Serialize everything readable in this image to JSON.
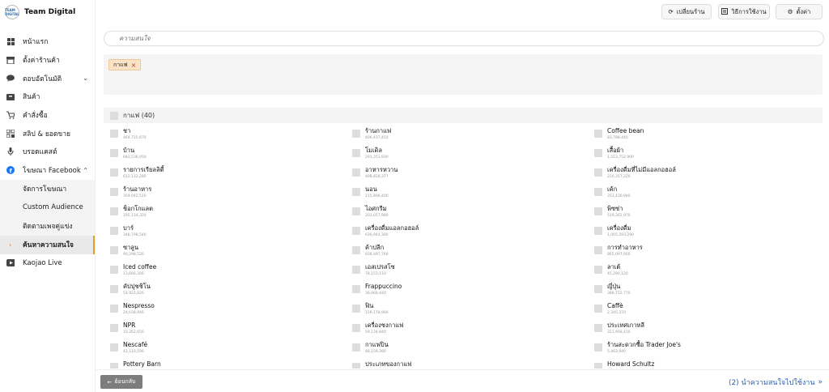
{
  "brand": {
    "logo_text": "TEAM DIGITAL",
    "name": "Team Digital"
  },
  "top_buttons": [
    {
      "label": "เปลี่ยนร้าน",
      "icon": "refresh-icon"
    },
    {
      "label": "วิธีการใช้งาน",
      "icon": "book-icon"
    },
    {
      "label": "ตั้งค่า",
      "icon": "gear-icon"
    }
  ],
  "sidebar": {
    "items": [
      {
        "label": "หน้าแรก",
        "icon": "grid-icon"
      },
      {
        "label": "ตั้งค่าร้านค้า",
        "icon": "store-icon"
      },
      {
        "label": "ตอบอัตโนมัติ",
        "icon": "chat-icon"
      },
      {
        "label": "สินค้า",
        "icon": "box-icon"
      },
      {
        "label": "คำสั่งซื้อ",
        "icon": "cart-icon"
      },
      {
        "label": "สลิป & ยอดขาย",
        "icon": "receipt-icon"
      },
      {
        "label": "บรอดแคสต์",
        "icon": "mic-icon"
      },
      {
        "label": "โฆษณา Facebook",
        "icon": "facebook-icon"
      }
    ],
    "sub_items": [
      {
        "label": "จัดการโฆษณา"
      },
      {
        "label": "Custom Audience"
      },
      {
        "label": "ติดตามเพจคู่แข่ง"
      },
      {
        "label": "ค้นหาความสนใจ"
      }
    ],
    "last_item": {
      "label": "Kaojao Live",
      "icon": "live-icon"
    }
  },
  "search": {
    "placeholder": "ความสนใจ"
  },
  "selected": [
    {
      "label": "กาแฟ"
    }
  ],
  "group": {
    "title": "กาแฟ (40)"
  },
  "interests": {
    "col1": [
      {
        "label": "ชา",
        "count": "464,725,670"
      },
      {
        "label": "บ้าน",
        "count": "683,536,950"
      },
      {
        "label": "รายการเรียลลิตี้",
        "count": "612,132,280"
      },
      {
        "label": "ร้านอาหาร",
        "count": "359,042,510"
      },
      {
        "label": "ช็อกโกแลต",
        "count": "195,134,320"
      },
      {
        "label": "บาร์",
        "count": "348,798,540"
      },
      {
        "label": "ซาลูน",
        "count": "90,298,520"
      },
      {
        "label": "Iced coffee",
        "count": "13,666,300"
      },
      {
        "label": "คัปปุชชิโน",
        "count": "54,922,820"
      },
      {
        "label": "Nespresso",
        "count": "24,038,940"
      },
      {
        "label": "NPR",
        "count": "33,262,650"
      },
      {
        "label": "Nescafé",
        "count": "42,110,590"
      },
      {
        "label": "Pottery Barn",
        "count": ""
      }
    ],
    "col2": [
      {
        "label": "ร้านกาแฟ",
        "count": "406,437,450"
      },
      {
        "label": "โมเดิล",
        "count": "291,353,930"
      },
      {
        "label": "อาหารหวาน",
        "count": "498,828,377"
      },
      {
        "label": "นอน",
        "count": "215,806,400"
      },
      {
        "label": "ไอศกรีม",
        "count": "202,657,980"
      },
      {
        "label": "เครื่องดื่มแอลกอฮอล์",
        "count": "636,944,300"
      },
      {
        "label": "ค้าปลีก",
        "count": "838,497,760"
      },
      {
        "label": "เอสเปรสโซ",
        "count": "78,153,110"
      },
      {
        "label": "Frappuccino",
        "count": "36,068,440"
      },
      {
        "label": "ฟิน",
        "count": "159,178,900"
      },
      {
        "label": "เครื่องชงกาแฟ",
        "count": "59,134,840"
      },
      {
        "label": "กาแฟปิน",
        "count": "48,159,380"
      },
      {
        "label": "ประเภทของกาแฟ",
        "count": ""
      }
    ],
    "col3": [
      {
        "label": "Coffee bean",
        "count": "83,788,440"
      },
      {
        "label": "เสื้อผ้า",
        "count": "1,553,752,900"
      },
      {
        "label": "เครื่องดื่มที่ไม่มีแอลกอฮอล์",
        "count": "220,357,220"
      },
      {
        "label": "เค้ก",
        "count": "353,430,940"
      },
      {
        "label": "พิซซ่า",
        "count": "519,362,970"
      },
      {
        "label": "เครื่องดื่ม",
        "count": "1,005,593,290"
      },
      {
        "label": "การทำอาหาร",
        "count": "865,097,950"
      },
      {
        "label": "ลาเต้",
        "count": "45,290,120"
      },
      {
        "label": "ญี่ปุ่น",
        "count": "388,752,770"
      },
      {
        "label": "Caffè",
        "count": "2,345,370"
      },
      {
        "label": "ประเทศเกาหลี",
        "count": "321,958,410"
      },
      {
        "label": "ร้านสะดวกซื้อ Trader Joe's",
        "count": "5,463,940"
      },
      {
        "label": "Howard Schultz",
        "count": ""
      }
    ]
  },
  "footer": {
    "back_label": "ย้อนกลับ",
    "next_label": "(2) นำความสนใจไปใช้งาน"
  }
}
